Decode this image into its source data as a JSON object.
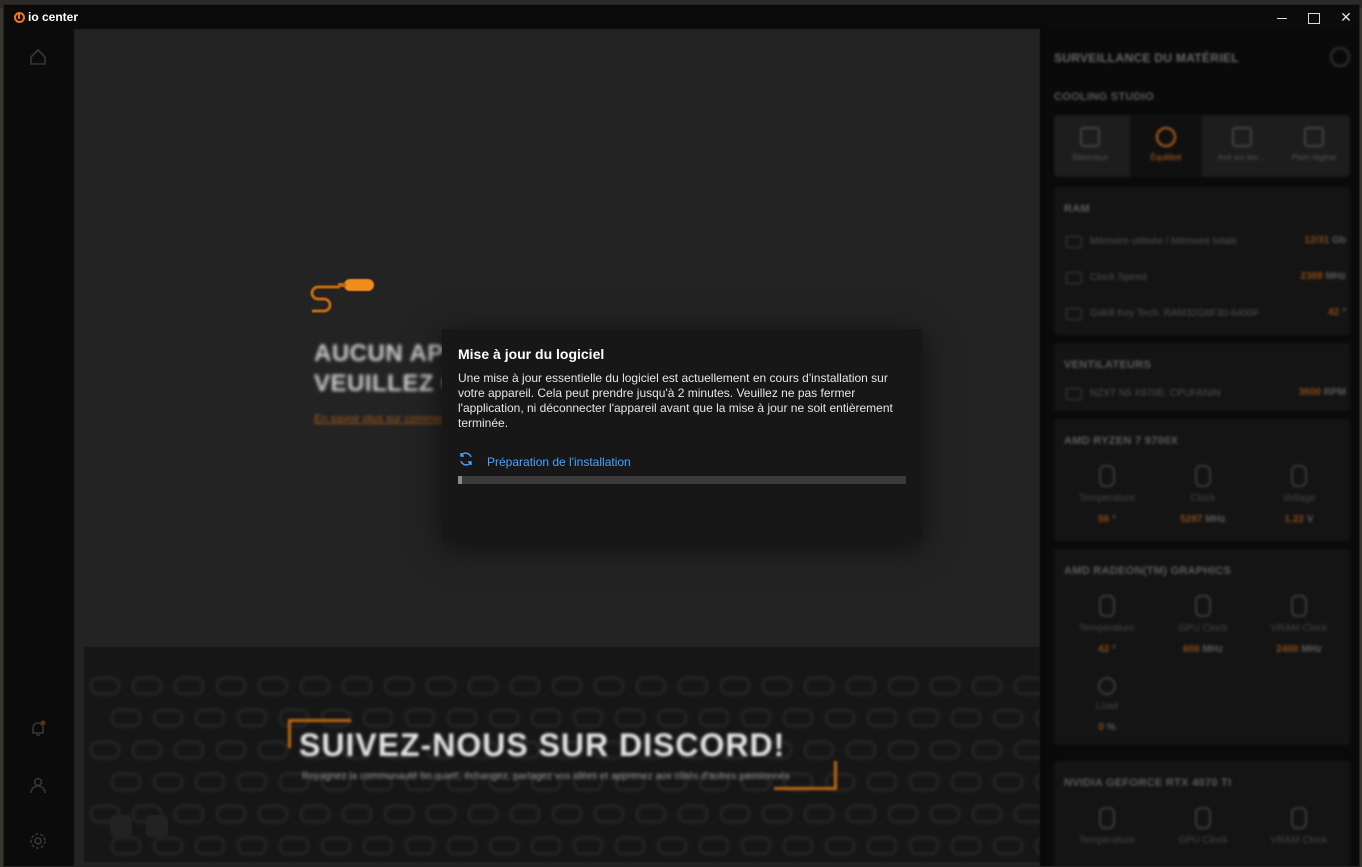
{
  "app": {
    "name": "io center"
  },
  "window_controls": {
    "minimize": "minimize",
    "maximize": "maximize",
    "close": "✕"
  },
  "sidebar": {
    "icons": [
      "home-icon",
      "notification-icon",
      "user-icon",
      "settings-icon"
    ]
  },
  "main": {
    "empty_title_line1": "AUCUN APPAREIL CONNECTÉ",
    "empty_title_line2": "VEUILLEZ CONNECTER UN APPAREIL",
    "empty_link": "En savoir plus sur comment connecter",
    "banner": {
      "title": "SUIVEZ-NOUS SUR DISCORD!",
      "subtitle": "Rejoignez la communauté bo quiet!, échangez, partagez vos idées et apprenez aux côtés d'autres passionnés"
    }
  },
  "right_panel": {
    "title": "SURVEILLANCE DU MATÉRIEL",
    "cooling_title": "COOLING STUDIO",
    "modes": [
      {
        "label": "Silencieux",
        "active": false
      },
      {
        "label": "Équilibré",
        "active": true
      },
      {
        "label": "Axé sur les ...",
        "active": false
      },
      {
        "label": "Plein régime",
        "active": false
      }
    ],
    "ram": {
      "title": "RAM",
      "rows": [
        {
          "label": "Mémoire utilisée / Mémoire totale",
          "value": "12/31",
          "unit": "Gb"
        },
        {
          "label": "Clock Speed",
          "value": "2388",
          "unit": "MHz"
        },
        {
          "label": "Gskill Key Tech. RAM32G6F30-6400F",
          "value": "42",
          "unit": "°"
        }
      ]
    },
    "fans": {
      "title": "VENTILATEURS",
      "rows": [
        {
          "label": "NZXT N5 X870E: CPUFANIN",
          "value": "3600",
          "unit": "RPM"
        }
      ]
    },
    "cpu": {
      "title": "AMD RYZEN 7 9700X",
      "metrics": [
        {
          "label": "Temperature",
          "value": "56",
          "unit": "°"
        },
        {
          "label": "Clock",
          "value": "5287",
          "unit": "MHz"
        },
        {
          "label": "Voltage",
          "value": "1.22",
          "unit": "V"
        }
      ]
    },
    "igpu": {
      "title": "AMD RADEON(TM) GRAPHICS",
      "metrics": [
        {
          "label": "Temperature",
          "value": "42",
          "unit": "°"
        },
        {
          "label": "GPU Clock",
          "value": "600",
          "unit": "MHz"
        },
        {
          "label": "VRAM Clock",
          "value": "2400",
          "unit": "MHz"
        },
        {
          "label": "Load",
          "value": "0",
          "unit": "%"
        }
      ]
    },
    "gpu": {
      "title": "NVIDIA GEFORCE RTX 4070 TI",
      "metrics": [
        {
          "label": "Temperature"
        },
        {
          "label": "GPU Clock"
        },
        {
          "label": "VRAM Clock"
        }
      ]
    }
  },
  "dialog": {
    "title": "Mise à jour du logiciel",
    "body": "Une mise à jour essentielle du logiciel est actuellement en cours d'installation sur votre appareil. Cela peut prendre jusqu'à 2 minutes. Veuillez ne pas fermer l'application, ni déconnecter l'appareil avant que la mise à jour ne soit entièrement terminée.",
    "status": "Préparation de l'installation",
    "status_icon": "refresh-icon",
    "progress": 0.01,
    "accent": "#4aa3ff",
    "brand": "#f07a14"
  }
}
